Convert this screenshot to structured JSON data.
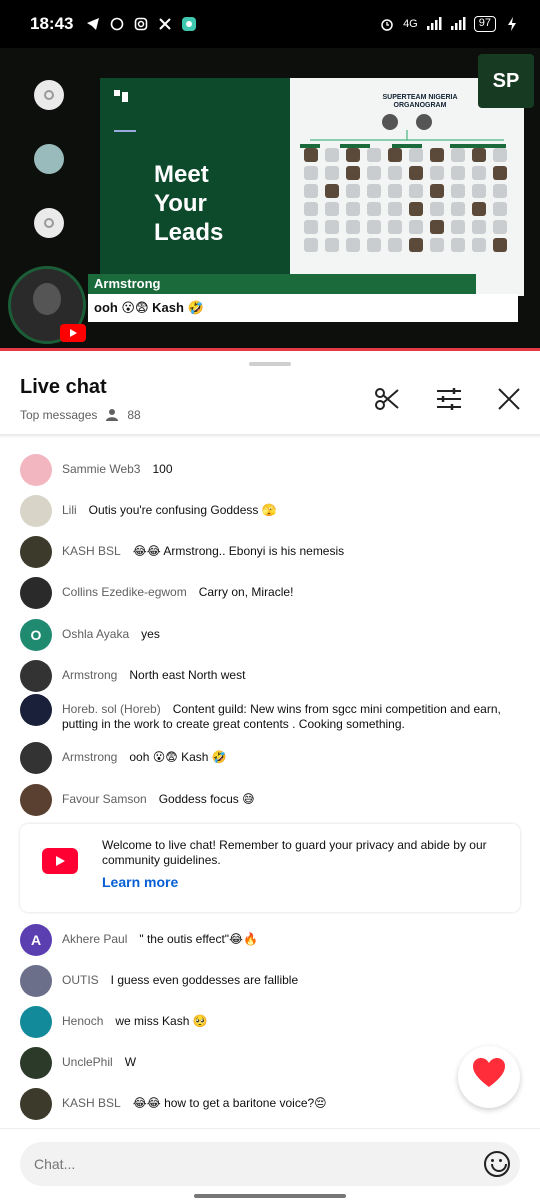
{
  "status_bar": {
    "time": "18:43",
    "battery": "97",
    "network": "4G"
  },
  "stream": {
    "slide_title": "Meet\nYour\nLeads",
    "org_title": "SUPERTEAM NIGERIA ORGANOGRAM",
    "brand_badge": "SP",
    "overlay_name": "Armstrong",
    "overlay_message": "ooh 😮😨 Kash 🤣"
  },
  "chat_header": {
    "title": "Live chat",
    "subtitle": "Top messages",
    "viewer_count": "88"
  },
  "messages": [
    {
      "author": "Sammie Web3",
      "text": "100",
      "avatar_color": "#f2b6c0",
      "avatar_letter": ""
    },
    {
      "author": "Lili",
      "text": "Outis you're confusing Goddess 🫣",
      "avatar_color": "#d9d4c8",
      "avatar_letter": ""
    },
    {
      "author": "KASH BSL",
      "text": "😂😂 Armstrong.. Ebonyi is his nemesis",
      "avatar_color": "#3c3a2a",
      "avatar_letter": ""
    },
    {
      "author": "Collins Ezedike-egwom",
      "text": "Carry on, Miracle!",
      "avatar_color": "#2a2a2a",
      "avatar_letter": ""
    },
    {
      "author": "Oshla Ayaka",
      "text": "yes",
      "avatar_color": "#1f8a70",
      "avatar_letter": "O"
    },
    {
      "author": "Armstrong",
      "text": "North east North west",
      "avatar_color": "#333333",
      "avatar_letter": ""
    },
    {
      "author": "Horeb. sol (Horeb)",
      "text": "Content guild: New wins from sgcc mini competition and earn, putting in the work to create great contents . Cooking something.",
      "avatar_color": "#1a1f3a",
      "avatar_letter": ""
    },
    {
      "author": "Armstrong",
      "text": "ooh 😮😨 Kash 🤣",
      "avatar_color": "#333333",
      "avatar_letter": ""
    },
    {
      "author": "Favour Samson",
      "text": "Goddess focus 😅",
      "avatar_color": "#5a4030",
      "avatar_letter": ""
    },
    {
      "author": "Akhere Paul",
      "text": "\" the outis effect\"😂🔥",
      "avatar_color": "#5b3fb0",
      "avatar_letter": "A"
    },
    {
      "author": "OUTIS",
      "text": "I guess even goddesses are fallible",
      "avatar_color": "#6b6f8a",
      "avatar_letter": ""
    },
    {
      "author": "Henoch",
      "text": "we miss Kash 🥺",
      "avatar_color": "#138a9a",
      "avatar_letter": ""
    },
    {
      "author": "UnclePhil",
      "text": "W",
      "avatar_color": "#2c3a2a",
      "avatar_letter": ""
    },
    {
      "author": "KASH BSL",
      "text": "😂😂 how to get a baritone voice?😔",
      "avatar_color": "#3c3a2a",
      "avatar_letter": ""
    }
  ],
  "welcome": {
    "text": "Welcome to live chat! Remember to guard your privacy and abide by our community guidelines.",
    "link": "Learn more"
  },
  "input": {
    "placeholder": "Chat..."
  },
  "colors": {
    "accent_link": "#065fd4",
    "youtube_red": "#ff0033",
    "slide_green": "#0d4a2c"
  }
}
